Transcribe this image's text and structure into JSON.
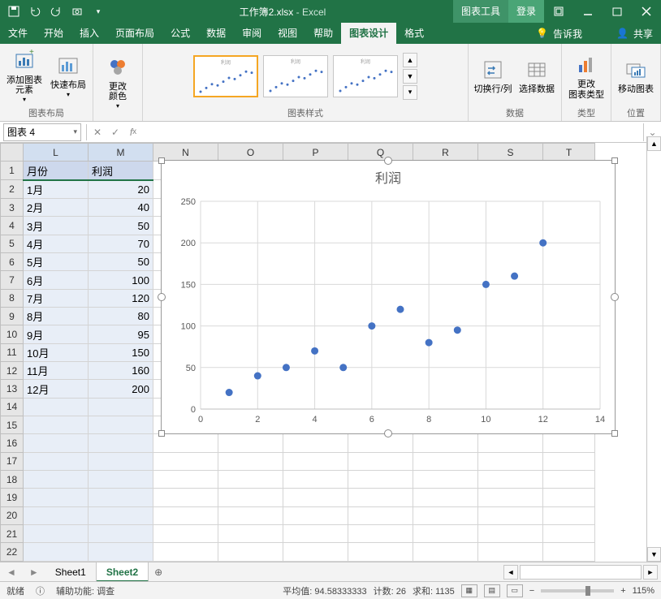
{
  "app": {
    "filename": "工作簿2.xlsx",
    "suffix": " - Excel"
  },
  "titlebar": {
    "tool_tab": "图表工具",
    "login": "登录"
  },
  "ribbon_tabs": [
    "文件",
    "开始",
    "插入",
    "页面布局",
    "公式",
    "数据",
    "审阅",
    "视图",
    "帮助",
    "图表设计",
    "格式"
  ],
  "ribbon_active": "图表设计",
  "tell_me": "告诉我",
  "share": "共享",
  "ribbon_groups": {
    "layout": {
      "label": "图表布局",
      "add_elem": "添加图表\n元素",
      "quick": "快速布局"
    },
    "color": {
      "label": "",
      "change_color": "更改\n颜色"
    },
    "styles": {
      "label": "图表样式",
      "items": [
        "利润",
        "利润",
        "利润"
      ]
    },
    "data": {
      "label": "数据",
      "switch": "切换行/列",
      "select": "选择数据"
    },
    "type": {
      "label": "类型",
      "change": "更改\n图表类型"
    },
    "loc": {
      "label": "位置",
      "move": "移动图表"
    }
  },
  "name_box": "图表 4",
  "columns": [
    "L",
    "M",
    "N",
    "O",
    "P",
    "Q",
    "R",
    "S",
    "T"
  ],
  "rows": [
    1,
    2,
    3,
    4,
    5,
    6,
    7,
    8,
    9,
    10,
    11,
    12,
    13,
    14,
    15,
    16,
    17,
    18,
    19,
    20,
    21,
    22
  ],
  "table": {
    "headers": {
      "month": "月份",
      "profit": "利润"
    },
    "data": [
      {
        "m": "1月",
        "v": 20
      },
      {
        "m": "2月",
        "v": 40
      },
      {
        "m": "3月",
        "v": 50
      },
      {
        "m": "4月",
        "v": 70
      },
      {
        "m": "5月",
        "v": 50
      },
      {
        "m": "6月",
        "v": 100
      },
      {
        "m": "7月",
        "v": 120
      },
      {
        "m": "8月",
        "v": 80
      },
      {
        "m": "9月",
        "v": 95
      },
      {
        "m": "10月",
        "v": 150
      },
      {
        "m": "11月",
        "v": 160
      },
      {
        "m": "12月",
        "v": 200
      }
    ]
  },
  "chart_data": {
    "type": "scatter",
    "title": "利润",
    "x": [
      1,
      2,
      3,
      4,
      5,
      6,
      7,
      8,
      9,
      10,
      11,
      12
    ],
    "y": [
      20,
      40,
      50,
      70,
      50,
      100,
      120,
      80,
      95,
      150,
      160,
      200
    ],
    "x_ticks": [
      0,
      2,
      4,
      6,
      8,
      10,
      12,
      14
    ],
    "y_ticks": [
      0,
      50,
      100,
      150,
      200,
      250
    ],
    "xlim": [
      0,
      14
    ],
    "ylim": [
      0,
      250
    ]
  },
  "sheets": {
    "tabs": [
      "Sheet1",
      "Sheet2"
    ],
    "active": "Sheet2"
  },
  "status": {
    "ready": "就绪",
    "acc": "辅助功能: 调查",
    "avg_label": "平均值:",
    "avg": "94.58333333",
    "count_label": "计数:",
    "count": "26",
    "sum_label": "求和:",
    "sum": "1135",
    "zoom": "115%"
  }
}
